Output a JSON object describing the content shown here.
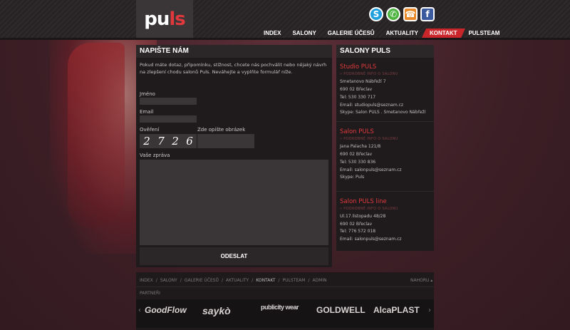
{
  "header": {
    "logo": {
      "part1": "pu",
      "part2": "ls"
    },
    "social": [
      {
        "name": "skype",
        "glyph": "S",
        "color": "#1f9fdc"
      },
      {
        "name": "whatsapp",
        "glyph": "✆",
        "color": "#4bb33e"
      },
      {
        "name": "phone",
        "glyph": "☎",
        "color": "#e98a2a"
      },
      {
        "name": "facebook",
        "glyph": "f",
        "color": "#3b5b9e"
      }
    ],
    "nav": [
      "INDEX",
      "SALONY",
      "GALERIE ÚČESŮ",
      "AKTUALITY",
      "KONTAKT",
      "PULSTEAM"
    ],
    "nav_active": "KONTAKT"
  },
  "form": {
    "title": "NAPIŠTE NÁM",
    "intro": "Pokud máte dotaz, připomínku, stížnost, chcete nás pochválit nebo nějaký návrh na zlepšení chodu salonů Puls. Neváhejte a vyplňte formulář níže.",
    "name_label": "Jméno",
    "email_label": "Email",
    "verify_label": "Ověření",
    "captcha_label": "Zde opište obrázek",
    "captcha_digits": [
      "2",
      "7",
      "2",
      "6"
    ],
    "message_label": "Vaše zpráva",
    "submit_label": "ODESLAT"
  },
  "salons": {
    "title": "SALONY PULS",
    "more_label": "» PODROBNÉ INFO O SALONU",
    "items": [
      {
        "name": "Studio PULS",
        "lines": [
          "Smetanovo Nábřeží 7",
          "690 02 Břeclav",
          "Tel: 530 330 717",
          "Email: studiopuls@seznam.cz",
          "Skype: Salon PULS . Smetanovo Nábřeží"
        ]
      },
      {
        "name": "Salon PULS",
        "lines": [
          "Jana Palacha 121/8",
          "690 02 Břeclav",
          "Tel: 530 330 836",
          "Email: salonpuls@seznam.cz",
          "Skype: Puls"
        ]
      },
      {
        "name": "Salon PULS line",
        "lines": [
          "Ul.17.listopadu 48/28",
          "690 02 Břeclav",
          "Tel: 776 572 018",
          "Email: salonpuls@seznam.cz"
        ]
      }
    ]
  },
  "footer": {
    "nav": [
      "INDEX",
      "SALONY",
      "GALERIE ÚČESŮ",
      "AKTUALITY",
      "KONTAKT",
      "PULSTEAM",
      "ADMIN"
    ],
    "nav_active": "KONTAKT",
    "top_label": "NAHORU",
    "partners_label": "PARTNEŘI",
    "partners": [
      "GoodFlow",
      "saykò",
      "publicity wear",
      "GOLDWELL",
      "AlcaPLAST"
    ]
  }
}
